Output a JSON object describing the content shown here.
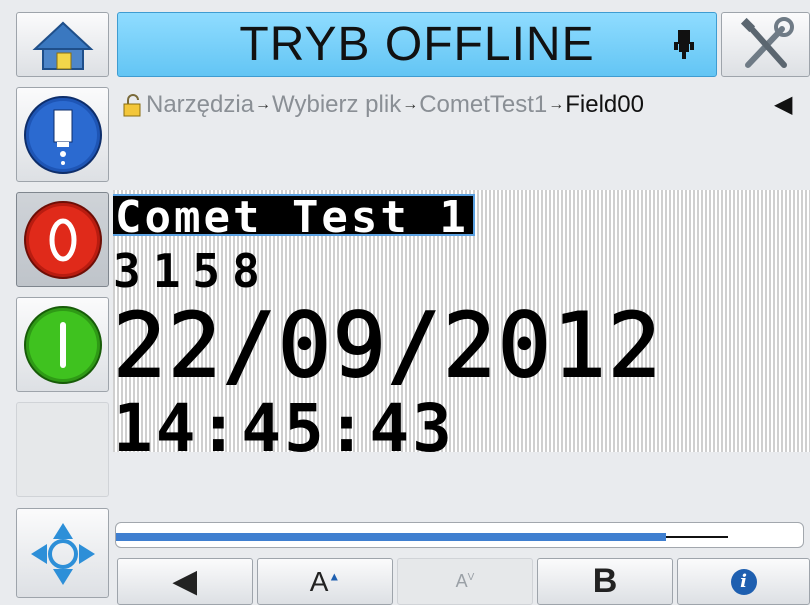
{
  "header": {
    "title": "TRYB OFFLINE",
    "home_icon": "home-icon",
    "tools_icon": "tools-icon",
    "print_head_icon": "print-head-icon"
  },
  "breadcrumb": {
    "items": [
      "Narzędzia",
      "Wybierz plik",
      "CometTest1",
      "Field00"
    ],
    "separator": "→",
    "back_glyph": "◀"
  },
  "side_buttons": [
    "ink-drop-icon",
    "stop-icon",
    "start-icon",
    "navigate-icon"
  ],
  "print_preview": {
    "lines": [
      "Comet Test 1",
      "3158",
      "22/09/2012",
      "14:45:43"
    ]
  },
  "progress": {
    "value": 0.8
  },
  "toolbar": {
    "prev_label": "◀",
    "font_size_up": "A",
    "font_size_up_mark": "▲",
    "spacing_label": "A",
    "spacing_mark": "V",
    "bold_label": "B",
    "info_label": "i"
  },
  "colors": {
    "title_bar": "#6fcaf5",
    "progress_fill": "#3f7fd0",
    "stop_red": "#e02a1a",
    "start_green": "#3fc21f"
  }
}
